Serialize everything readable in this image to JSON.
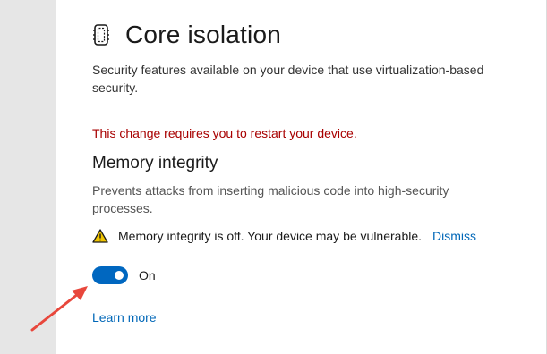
{
  "page": {
    "title": "Core isolation",
    "title_icon": "core-isolation-chip-icon",
    "description": "Security features available on your device that use virtualization-based security."
  },
  "restart_warning": "This change requires you to restart your device.",
  "memory_integrity": {
    "title": "Memory integrity",
    "description": "Prevents attacks from inserting malicious code into high-security processes.",
    "alert": {
      "icon": "warning-icon",
      "text": "Memory integrity is off. Your device may be vulnerable.",
      "dismiss_label": "Dismiss"
    },
    "toggle": {
      "state_label": "On",
      "checked": true
    },
    "learn_more_label": "Learn more"
  },
  "annotation": {
    "icon": "red-arrow-icon"
  },
  "colors": {
    "accent": "#0067c0",
    "link": "#0067b8",
    "warning_text": "#a80000",
    "warning_icon": "#f0c400",
    "annotation_arrow": "#e8473c",
    "sidebar": "#e6e6e6"
  }
}
